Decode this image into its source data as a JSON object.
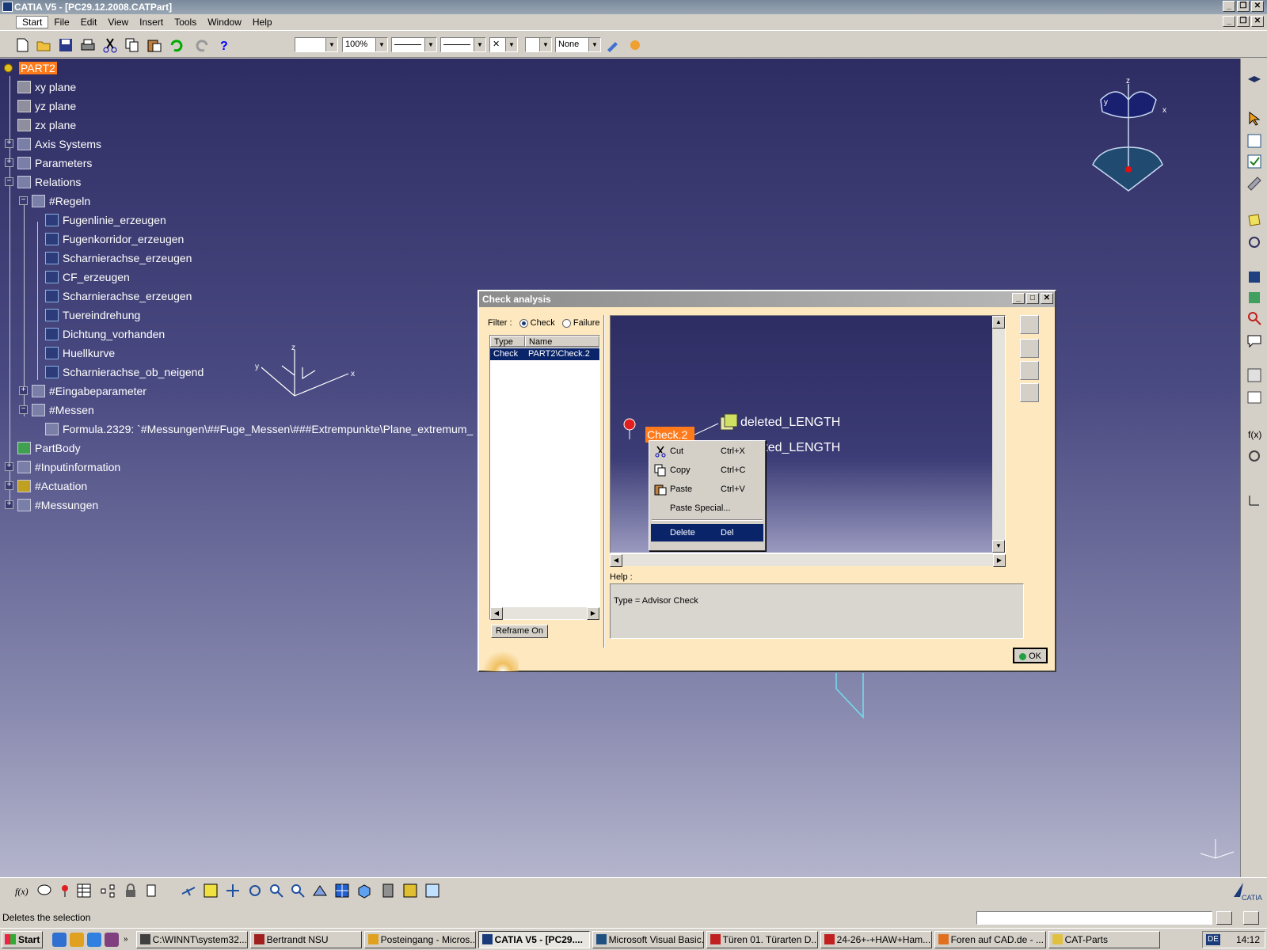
{
  "window": {
    "title": "CATIA V5 - [PC29.12.2008.CATPart]"
  },
  "menu": [
    "Start",
    "File",
    "Edit",
    "View",
    "Insert",
    "Tools",
    "Window",
    "Help"
  ],
  "toolbar": {
    "zoom": "100%",
    "layer": "None"
  },
  "tree": {
    "root": "PART2",
    "planes": [
      "xy plane",
      "yz plane",
      "zx plane"
    ],
    "axis_systems": "Axis Systems",
    "parameters": "Parameters",
    "relations": "Relations",
    "regeln": "#Regeln",
    "rules": [
      "Fugenlinie_erzeugen",
      "Fugenkorridor_erzeugen",
      "Scharnierachse_erzeugen",
      "CF_erzeugen",
      "Scharnierachse_erzeugen",
      "Tuereindrehung",
      "Dichtung_vorhanden",
      "Huellkurve",
      "Scharnierachse_ob_neigend"
    ],
    "eingabeparameter": "#Eingabeparameter",
    "messen": "#Messen",
    "formula": "Formula.2329: `#Messungen\\##Fuge_Messen\\###Extrempunkte\\Plane_extremum_",
    "partbody": "PartBody",
    "inputinformation": "#Inputinformation",
    "actuation": "#Actuation",
    "messungen": "#Messungen"
  },
  "dialog": {
    "title": "Check analysis",
    "filter_label": "Filter :",
    "filter_check": "Check",
    "filter_failure": "Failure",
    "columns": [
      "Type",
      "Name"
    ],
    "rows": [
      {
        "type": "Check",
        "name": "PART2\\Check.2"
      }
    ],
    "reframe_button": "Reframe On",
    "help_label": "Help :",
    "help_text": "Type = Advisor Check",
    "ok_button": "OK",
    "graph": {
      "node_label": "Check.2",
      "param1": "deleted_LENGTH",
      "param2": "deleted_LENGTH"
    }
  },
  "context_menu": {
    "items": [
      {
        "label": "Cut",
        "shortcut": "Ctrl+X"
      },
      {
        "label": "Copy",
        "shortcut": "Ctrl+C"
      },
      {
        "label": "Paste",
        "shortcut": "Ctrl+V"
      },
      {
        "label": "Paste Special...",
        "shortcut": ""
      },
      {
        "label": "Delete",
        "shortcut": "Del"
      }
    ]
  },
  "compass": {
    "x": "x",
    "y": "y",
    "z": "z"
  },
  "axis_widget": {
    "x": "x",
    "y": "y",
    "z": "z"
  },
  "status": "Deletes the selection",
  "taskbar": {
    "start": "Start",
    "tasks": [
      "C:\\WINNT\\system32...",
      "Bertrandt NSU",
      "Posteingang - Micros...",
      "CATIA V5 - [PC29....",
      "Microsoft Visual Basic...",
      "Türen 01. Türarten D...",
      "24-26+-+HAW+Ham...",
      "Foren auf CAD.de - ...",
      "CAT-Parts"
    ],
    "lang": "DE",
    "time": "14:12"
  }
}
